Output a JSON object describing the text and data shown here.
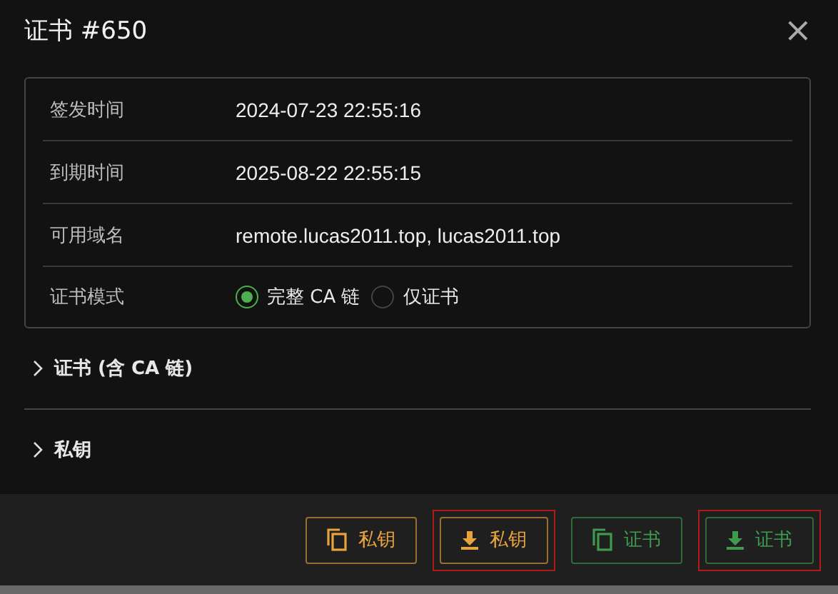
{
  "dialog": {
    "title": "证书 #650",
    "close_glyph": "×"
  },
  "details": [
    {
      "label": "签发时间",
      "value": "2024-07-23 22:55:16"
    },
    {
      "label": "到期时间",
      "value": "2025-08-22 22:55:15"
    },
    {
      "label": "可用域名",
      "value": "remote.lucas2011.top, lucas2011.top"
    }
  ],
  "mode": {
    "label": "证书模式",
    "options": [
      {
        "label": "完整 CA 链",
        "selected": true
      },
      {
        "label": "仅证书",
        "selected": false
      }
    ]
  },
  "sections": [
    {
      "title": "证书 (含 CA 链)",
      "expanded": false
    },
    {
      "title": "私钥",
      "expanded": false
    }
  ],
  "buttons": [
    {
      "kind": "copy",
      "color": "#e8a33d",
      "label": "私钥",
      "highlighted": false
    },
    {
      "kind": "download",
      "color": "#e8a33d",
      "label": "私钥",
      "highlighted": true
    },
    {
      "kind": "copy",
      "color": "#3f9a4e",
      "label": "证书",
      "highlighted": false
    },
    {
      "kind": "download",
      "color": "#3f9a4e",
      "label": "证书",
      "highlighted": true
    }
  ]
}
